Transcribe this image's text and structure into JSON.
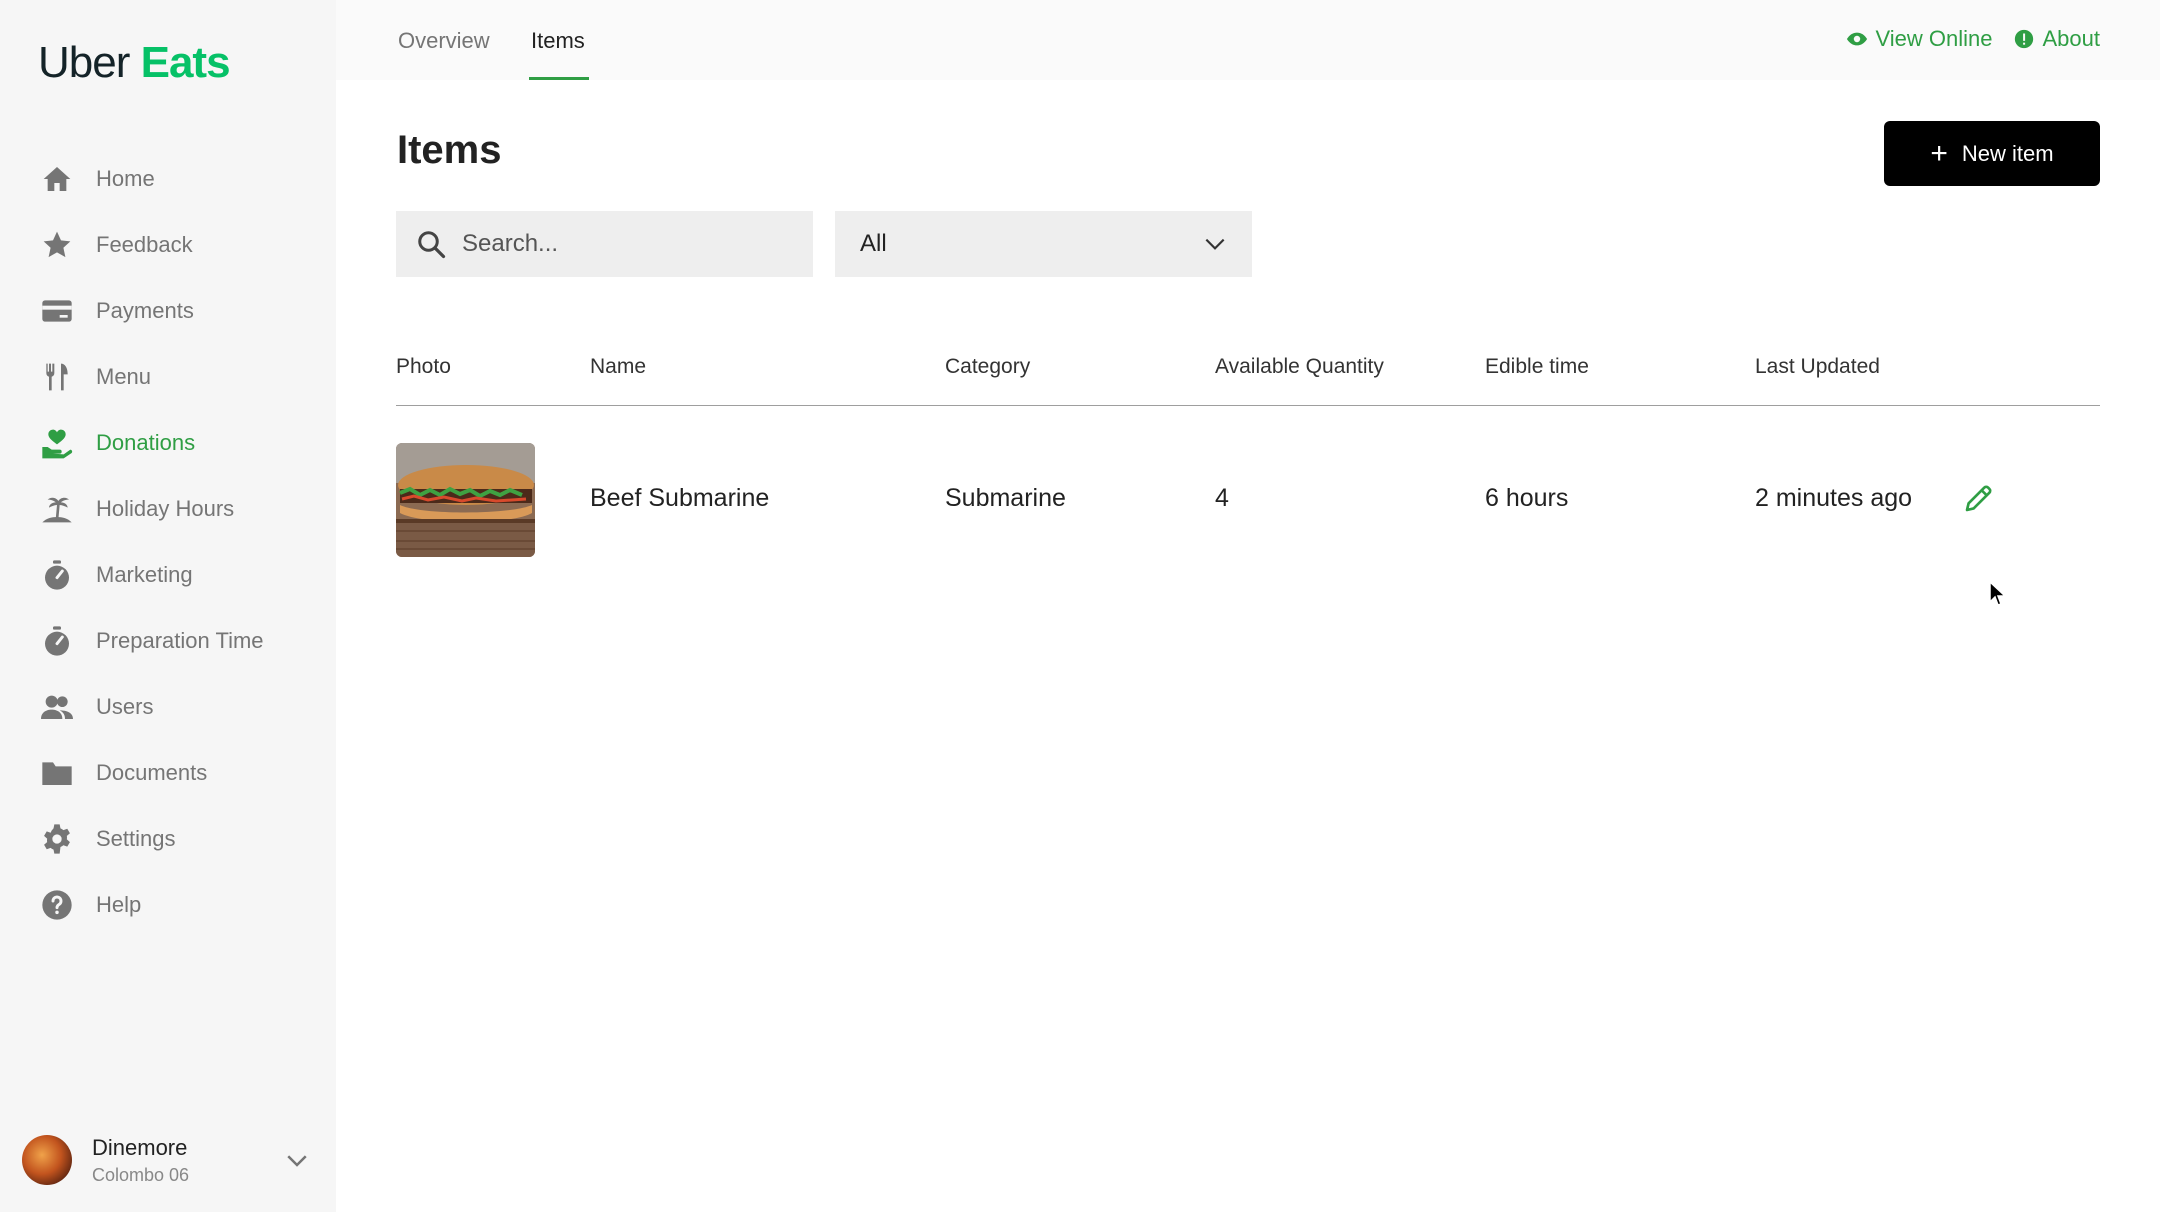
{
  "brand": {
    "uber": "Uber",
    "eats": "Eats",
    "accent": "#2f9e44"
  },
  "sidebar": {
    "items": [
      {
        "label": "Home",
        "icon": "home-icon"
      },
      {
        "label": "Feedback",
        "icon": "star-icon"
      },
      {
        "label": "Payments",
        "icon": "credit-card-icon"
      },
      {
        "label": "Menu",
        "icon": "utensils-icon"
      },
      {
        "label": "Donations",
        "icon": "hand-heart-icon",
        "active": true
      },
      {
        "label": "Holiday Hours",
        "icon": "palm-tree-icon"
      },
      {
        "label": "Marketing",
        "icon": "stopwatch-icon"
      },
      {
        "label": "Preparation Time",
        "icon": "stopwatch-icon"
      },
      {
        "label": "Users",
        "icon": "users-icon"
      },
      {
        "label": "Documents",
        "icon": "folder-icon"
      },
      {
        "label": "Settings",
        "icon": "gear-icon"
      },
      {
        "label": "Help",
        "icon": "help-icon"
      }
    ],
    "profile": {
      "name": "Dinemore",
      "location": "Colombo 06"
    }
  },
  "header": {
    "tabs": [
      {
        "label": "Overview"
      },
      {
        "label": "Items",
        "active": true
      }
    ],
    "links": {
      "view_online": "View Online",
      "about": "About"
    }
  },
  "main": {
    "title": "Items",
    "new_item_label": "New item",
    "search_placeholder": "Search...",
    "filter_value": "All",
    "table": {
      "columns": [
        "Photo",
        "Name",
        "Category",
        "Available Quantity",
        "Edible time",
        "Last Updated"
      ],
      "rows": [
        {
          "name": "Beef Submarine",
          "category": "Submarine",
          "quantity": "4",
          "edible_time": "6 hours",
          "last_updated": "2 minutes ago"
        }
      ]
    }
  }
}
